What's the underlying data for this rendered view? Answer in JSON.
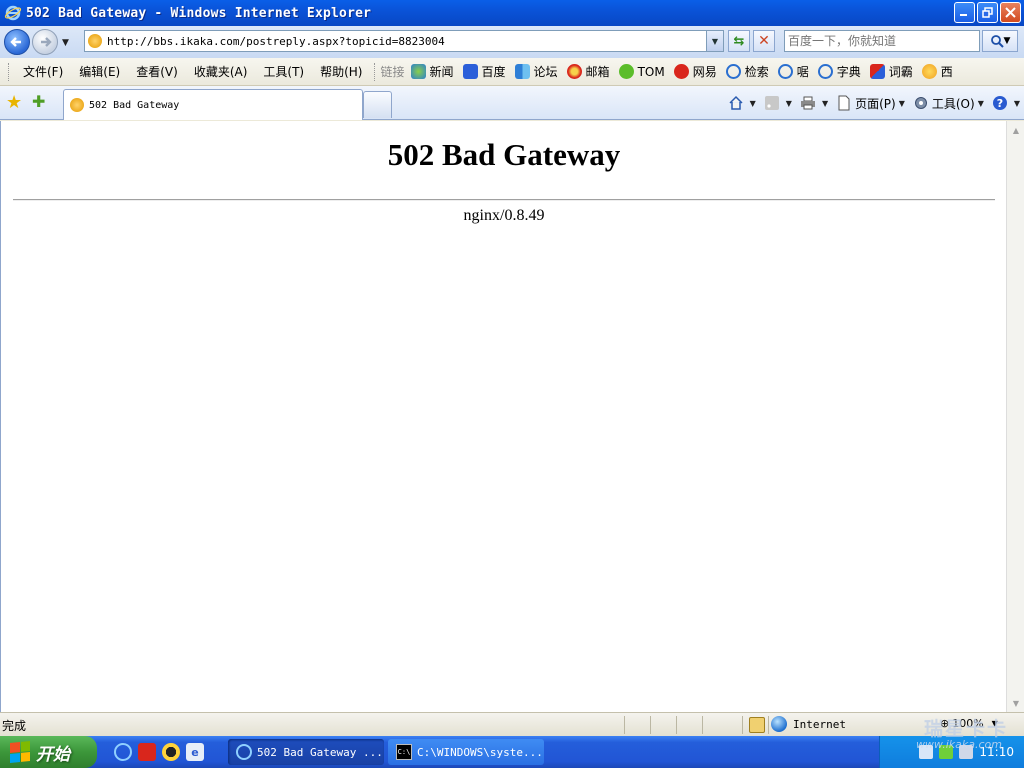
{
  "window": {
    "title": "502 Bad Gateway - Windows Internet Explorer"
  },
  "address": {
    "url": "http://bbs.ikaka.com/postreply.aspx?topicid=8823004",
    "search_placeholder": "百度一下，你就知道"
  },
  "menu": {
    "items": [
      "文件(F)",
      "编辑(E)",
      "查看(V)",
      "收藏夹(A)",
      "工具(T)",
      "帮助(H)"
    ]
  },
  "links": {
    "label": "链接",
    "items": [
      "新闻",
      "百度",
      "论坛",
      "邮箱",
      "TOM",
      "网易",
      "检索",
      "啹",
      "字典",
      "词霸",
      "西"
    ]
  },
  "tab": {
    "label": "502 Bad Gateway"
  },
  "commands": {
    "page": "页面(P)",
    "tools": "工具(O)"
  },
  "page": {
    "heading": "502 Bad Gateway",
    "server": "nginx/0.8.49"
  },
  "status": {
    "text": "完成",
    "zone": "Internet",
    "zoom": "100%"
  },
  "taskbar": {
    "start": "开始",
    "tasks": [
      "502 Bad Gateway ...",
      "C:\\WINDOWS\\syste..."
    ],
    "clock": "11:10"
  },
  "watermark": {
    "text": "瑞星卡卡",
    "url": "www.ikaka.com"
  },
  "colors": {
    "titlebar": "#0a53d8",
    "taskbar": "#245edb",
    "start": "#3c973a"
  }
}
